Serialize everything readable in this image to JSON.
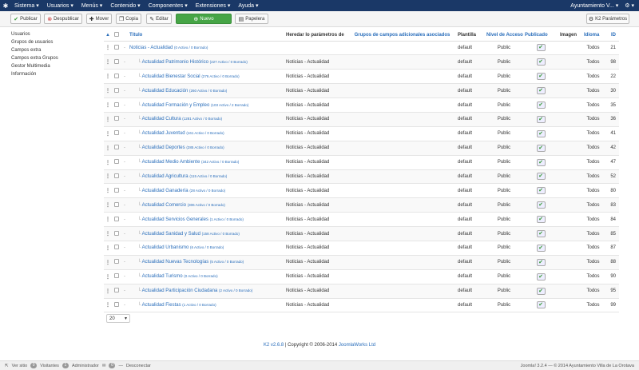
{
  "topbar": {
    "logo_icon": "joomla-icon",
    "menu": [
      "Sistema ▾",
      "Usuarios ▾",
      "Menús ▾",
      "Contenido ▾",
      "Componentes ▾",
      "Extensiones ▾",
      "Ayuda ▾"
    ],
    "user": "Ayuntamiento V...",
    "user_caret": "▾",
    "settings_icon": "⚙",
    "settings_caret": "▾"
  },
  "toolbar": {
    "publish": "Publicar",
    "unpublish": "Despublicar",
    "move": "Mover",
    "copy": "Copia",
    "edit": "Editar",
    "new": "Nuevo",
    "trash": "Papelera",
    "params": "K2 Parámetros"
  },
  "sidebar": [
    "Usuarios",
    "Grupos de usuarios",
    "Campos extra",
    "Campos extra Grupos",
    "Gestor Multimedia",
    "Información"
  ],
  "table": {
    "headers": {
      "order": "▲",
      "title": "Título",
      "inherit": "Heredar lo parámetros de",
      "groups": "Grupos de campos adicionales asociados",
      "template": "Plantilla",
      "access": "Nivel de Acceso",
      "published": "Publicado",
      "image": "Imagen",
      "language": "Idioma",
      "id": "ID"
    },
    "rows": [
      {
        "indent": false,
        "title": "Noticias - Actualidad",
        "meta": "(0 Activo / 0 Borrado)",
        "inherit": "",
        "template": "default",
        "access": "Public",
        "lang": "Todos",
        "id": "21"
      },
      {
        "indent": true,
        "title": "Actualidad Patrimonio Histórico",
        "meta": "(227 Activo / 0 Borrado)",
        "inherit": "Noticias - Actualidad",
        "template": "default",
        "access": "Public",
        "lang": "Todos",
        "id": "98"
      },
      {
        "indent": true,
        "title": "Actualidad Bienestar Social",
        "meta": "(276 Activo / 0 Borrado)",
        "inherit": "Noticias - Actualidad",
        "template": "default",
        "access": "Public",
        "lang": "Todos",
        "id": "22"
      },
      {
        "indent": true,
        "title": "Actualidad Educación",
        "meta": "(260 Activo / 0 Borrado)",
        "inherit": "Noticias - Actualidad",
        "template": "default",
        "access": "Public",
        "lang": "Todos",
        "id": "30"
      },
      {
        "indent": true,
        "title": "Actualidad Formación y Empleo",
        "meta": "(103 Activo / 2 Borrado)",
        "inherit": "Noticias - Actualidad",
        "template": "default",
        "access": "Public",
        "lang": "Todos",
        "id": "35"
      },
      {
        "indent": true,
        "title": "Actualidad Cultura",
        "meta": "(1281 Activo / 0 Borrado)",
        "inherit": "Noticias - Actualidad",
        "template": "default",
        "access": "Public",
        "lang": "Todos",
        "id": "36"
      },
      {
        "indent": true,
        "title": "Actualidad Juventud",
        "meta": "(161 Activo / 0 Borrado)",
        "inherit": "Noticias - Actualidad",
        "template": "default",
        "access": "Public",
        "lang": "Todos",
        "id": "41"
      },
      {
        "indent": true,
        "title": "Actualidad Deportes",
        "meta": "(285 Activo / 0 Borrado)",
        "inherit": "Noticias - Actualidad",
        "template": "default",
        "access": "Public",
        "lang": "Todos",
        "id": "42"
      },
      {
        "indent": true,
        "title": "Actualidad Medio Ambiente",
        "meta": "(342 Activo / 0 Borrado)",
        "inherit": "Noticias - Actualidad",
        "template": "default",
        "access": "Public",
        "lang": "Todos",
        "id": "47"
      },
      {
        "indent": true,
        "title": "Actualidad Agricultura",
        "meta": "(115 Activo / 0 Borrado)",
        "inherit": "Noticias - Actualidad",
        "template": "default",
        "access": "Public",
        "lang": "Todos",
        "id": "52"
      },
      {
        "indent": true,
        "title": "Actualidad Ganadería",
        "meta": "(28 Activo / 0 Borrado)",
        "inherit": "Noticias - Actualidad",
        "template": "default",
        "access": "Public",
        "lang": "Todos",
        "id": "80"
      },
      {
        "indent": true,
        "title": "Actualidad Comercio",
        "meta": "(306 Activo / 0 Borrado)",
        "inherit": "Noticias - Actualidad",
        "template": "default",
        "access": "Public",
        "lang": "Todos",
        "id": "83"
      },
      {
        "indent": true,
        "title": "Actualidad Servicios Generales",
        "meta": "(1 Activo / 0 Borrado)",
        "inherit": "Noticias - Actualidad",
        "template": "default",
        "access": "Public",
        "lang": "Todos",
        "id": "84"
      },
      {
        "indent": true,
        "title": "Actualidad Sanidad y Salud",
        "meta": "(158 Activo / 0 Borrado)",
        "inherit": "Noticias - Actualidad",
        "template": "default",
        "access": "Public",
        "lang": "Todos",
        "id": "85"
      },
      {
        "indent": true,
        "title": "Actualidad Urbanismo",
        "meta": "(6 Activo / 0 Borrado)",
        "inherit": "Noticias - Actualidad",
        "template": "default",
        "access": "Public",
        "lang": "Todos",
        "id": "87"
      },
      {
        "indent": true,
        "title": "Actualidad Nuevas Tecnologías",
        "meta": "(5 Activo / 0 Borrado)",
        "inherit": "Noticias - Actualidad",
        "template": "default",
        "access": "Public",
        "lang": "Todos",
        "id": "88"
      },
      {
        "indent": true,
        "title": "Actualidad Turismo",
        "meta": "(0 Activo / 0 Borrado)",
        "inherit": "Noticias - Actualidad",
        "template": "default",
        "access": "Public",
        "lang": "Todos",
        "id": "90"
      },
      {
        "indent": true,
        "title": "Actualidad Participación Ciudadana",
        "meta": "(2 Activo / 0 Borrado)",
        "inherit": "Noticias - Actualidad",
        "template": "default",
        "access": "Public",
        "lang": "Todos",
        "id": "95"
      },
      {
        "indent": true,
        "title": "Actualidad Fiestas",
        "meta": "(1 Activo / 0 Borrado)",
        "inherit": "Noticias - Actualidad",
        "template": "default",
        "access": "Public",
        "lang": "Todos",
        "id": "99"
      }
    ]
  },
  "pager": {
    "value": "20",
    "caret": "▾"
  },
  "footer": {
    "link": "K2 v2.6.8",
    "text": " | Copyright © 2006-2014 ",
    "link2": "JoomlaWorks Ltd"
  },
  "statusbar": {
    "view_site": "Ver sitio",
    "visitors_count": "0",
    "visitors": "Visitantes",
    "admin_count": "1",
    "admin": "Administrador",
    "messages_count": "0",
    "logout": "Desconectar",
    "right": "Joomla! 3.2.4 — © 2014 Ayuntamiento Villa de La Orotava"
  },
  "colors": {
    "topbar": "#1a3867",
    "link": "#2a6ebb",
    "new_button": "#46a546"
  }
}
